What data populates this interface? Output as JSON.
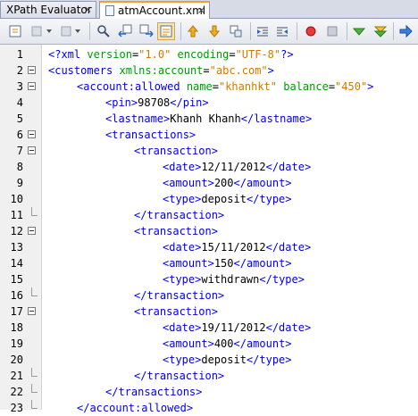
{
  "tabs": [
    {
      "label": "XPath Evaluator",
      "close": "×"
    },
    {
      "label": "atmAccount.xml",
      "close": "×"
    }
  ],
  "toolbar": {
    "icons": [
      "source-history-icon",
      "back-icon",
      "forward-icon",
      "find-icon",
      "find-previous-icon",
      "find-next-icon",
      "toggle-highlight-icon",
      "prev-bookmark-icon",
      "next-bookmark-icon",
      "toggle-bookmark-icon",
      "shift-left-icon",
      "shift-right-icon",
      "record-macro-icon",
      "stop-macro-icon",
      "check-xml-icon",
      "validate-xml-icon",
      "run-xslt-icon"
    ]
  },
  "editor": {
    "lines": [
      {
        "n": "1",
        "text": "<?xml version=\"1.0\" encoding=\"UTF-8\"?>"
      },
      {
        "n": "2",
        "text": "<customers xmlns:account=\"abc.com\">"
      },
      {
        "n": "3",
        "text": "<account:allowed name=\"khanhkt\" balance=\"450\">"
      },
      {
        "n": "4",
        "text": "<pin>98708</pin>"
      },
      {
        "n": "5",
        "text": "<lastname>Khanh Khanh</lastname>"
      },
      {
        "n": "6",
        "text": "<transactions>"
      },
      {
        "n": "7",
        "text": "<transaction>"
      },
      {
        "n": "8",
        "text": "<date>12/11/2012</date>"
      },
      {
        "n": "9",
        "text": "<amount>200</amount>"
      },
      {
        "n": "10",
        "text": "<type>deposit</type>"
      },
      {
        "n": "11",
        "text": "</transaction>"
      },
      {
        "n": "12",
        "text": "<transaction>"
      },
      {
        "n": "13",
        "text": "<date>15/11/2012</date>"
      },
      {
        "n": "14",
        "text": "<amount>150</amount>"
      },
      {
        "n": "15",
        "text": "<type>withdrawn</type>"
      },
      {
        "n": "16",
        "text": "</transaction>"
      },
      {
        "n": "17",
        "text": "<transaction>"
      },
      {
        "n": "18",
        "text": "<date>19/11/2012</date>"
      },
      {
        "n": "19",
        "text": "<amount>400</amount>"
      },
      {
        "n": "20",
        "text": "<type>deposit</type>"
      },
      {
        "n": "21",
        "text": "</transaction>"
      },
      {
        "n": "22",
        "text": "</transactions>"
      },
      {
        "n": "23",
        "text": "</account:allowed>"
      }
    ]
  },
  "colors": {
    "tag": "#0000e6",
    "attribute": "#009900",
    "value": "#ce7b00",
    "text": "#000000"
  }
}
